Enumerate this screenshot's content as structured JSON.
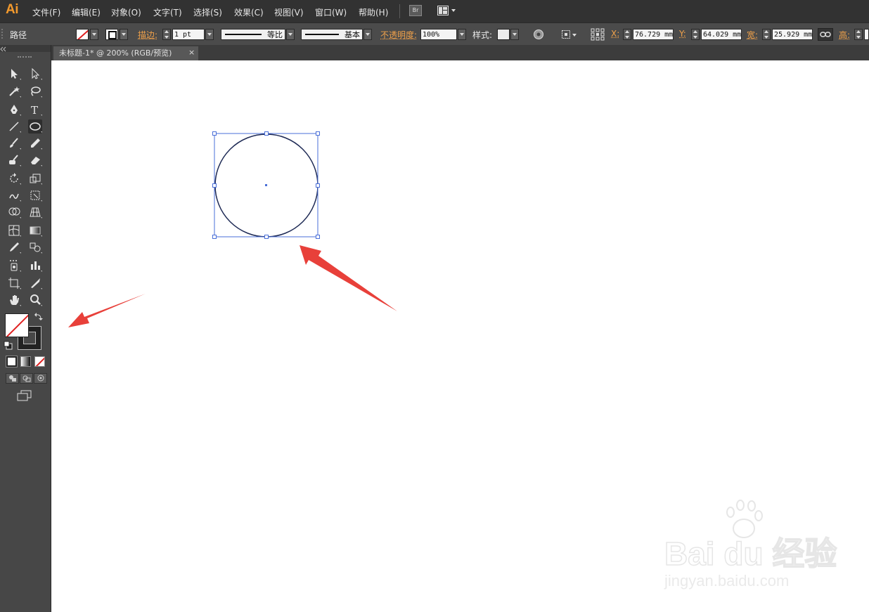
{
  "app": {
    "logo_text": "Ai",
    "menu": [
      "文件(F)",
      "编辑(E)",
      "对象(O)",
      "文字(T)",
      "选择(S)",
      "效果(C)",
      "视图(V)",
      "窗口(W)",
      "帮助(H)"
    ],
    "bridge_label": "Br"
  },
  "control_bar": {
    "selection_label": "路径",
    "stroke_label": "描边:",
    "stroke_weight": "1 pt",
    "profile_label": "等比",
    "brush_label": "基本",
    "opacity_label": "不透明度:",
    "opacity_value": "100%",
    "style_label": "样式:",
    "x_label": "X:",
    "x_value": "76.729 mm",
    "y_label": "Y:",
    "y_value": "64.029 mm",
    "w_label": "宽:",
    "w_value": "25.929 mm",
    "h_label": "高:"
  },
  "document": {
    "tab_title": "未标题-1* @ 200% (RGB/预览)",
    "close_glyph": "×"
  },
  "toolbar": {
    "tools": [
      "selection-tool",
      "direct-selection-tool",
      "magic-wand-tool",
      "lasso-tool",
      "pen-tool",
      "type-tool",
      "line-tool",
      "ellipse-tool",
      "paintbrush-tool",
      "pencil-tool",
      "blob-brush-tool",
      "eraser-tool",
      "rotate-tool",
      "scale-tool",
      "warp-tool",
      "free-transform-tool",
      "shape-builder-tool",
      "perspective-grid-tool",
      "mesh-tool",
      "gradient-tool",
      "eyedropper-tool",
      "blend-tool",
      "symbol-sprayer-tool",
      "column-graph-tool",
      "artboard-tool",
      "slice-tool",
      "hand-tool",
      "zoom-tool"
    ],
    "selected_tool": "ellipse-tool"
  },
  "colors": {
    "accent": "#f39a2d",
    "selection": "#4a6fd8",
    "annotation_arrow": "#e8403a",
    "none_slash": "#e02020"
  },
  "watermark": {
    "brand": "Bai du 经验",
    "url": "jingyan.baidu.com"
  }
}
